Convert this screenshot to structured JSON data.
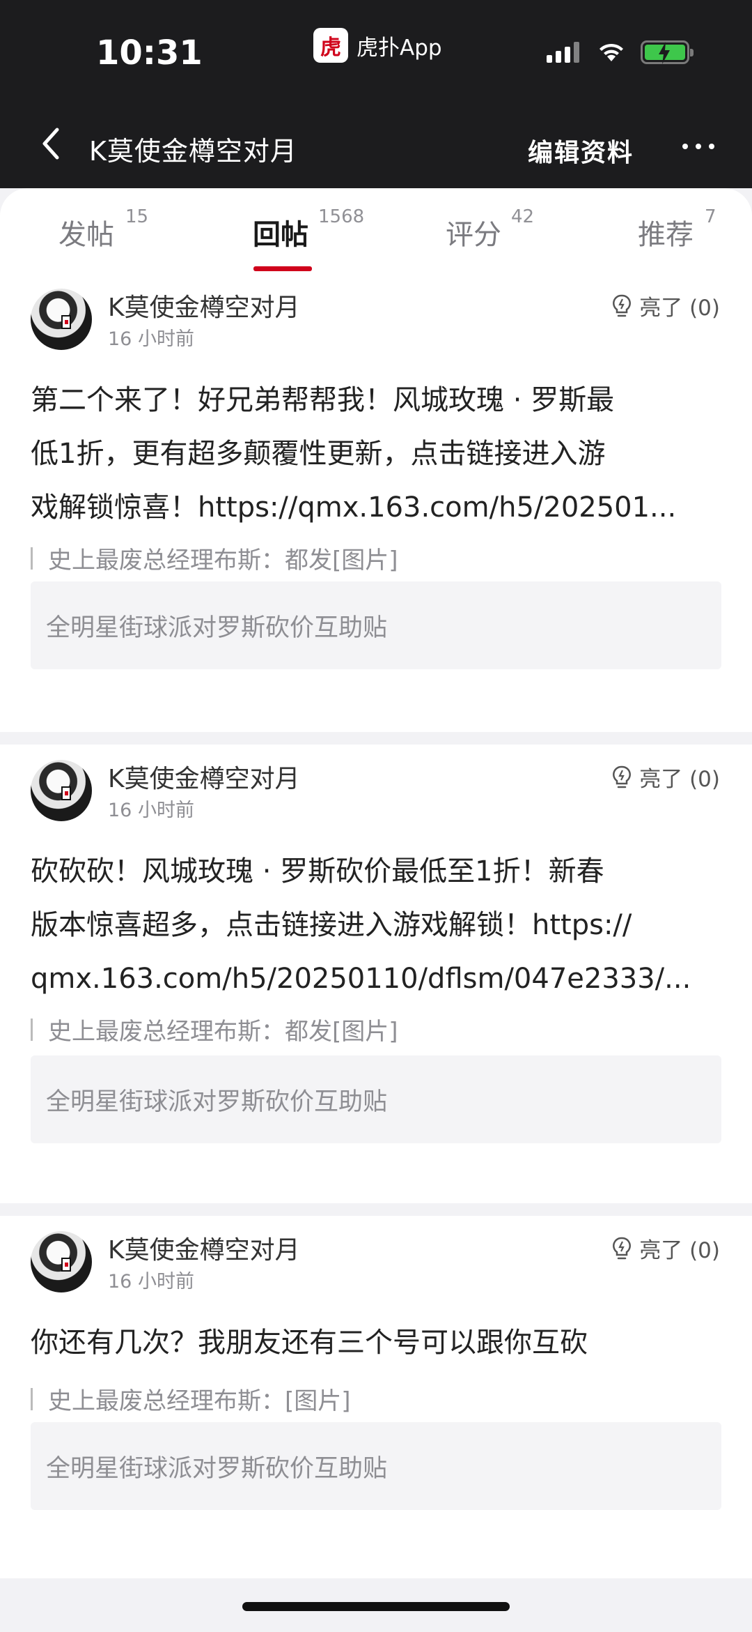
{
  "status_bar": {
    "time": "10:31",
    "app_logo_text": "虎",
    "app_name": "虎扑App",
    "battery_color": "#3ec74b"
  },
  "nav": {
    "title": "K莫使金樽空对月",
    "edit_label": "编辑资料",
    "back_icon": "chevron-left-icon",
    "more_icon": "more-dots-icon"
  },
  "tabs": [
    {
      "label": "发帖",
      "count": "15"
    },
    {
      "label": "回帖",
      "count": "1568",
      "active": true
    },
    {
      "label": "评分",
      "count": "42"
    },
    {
      "label": "推荐",
      "count": "7"
    }
  ],
  "accent_color": "#d0021b",
  "posts": [
    {
      "username": "K莫使金樽空对月",
      "time": "16 小时前",
      "light": "亮了 (0)",
      "lines": [
        "第二个来了！好兄弟帮帮我！风城玫瑰 · 罗斯最",
        "低1折，更有超多颠覆性更新，点击链接进入游",
        "戏解锁惊喜！https://qmx.163.com/h5/202501..."
      ],
      "quote": "史上最废总经理布斯：都发[图片]",
      "topic": "全明星街球派对罗斯砍价互助贴"
    },
    {
      "username": "K莫使金樽空对月",
      "time": "16 小时前",
      "light": "亮了 (0)",
      "lines": [
        "砍砍砍！风城玫瑰 · 罗斯砍价最低至1折！新春",
        "版本惊喜超多，点击链接进入游戏解锁！https://",
        "qmx.163.com/h5/20250110/dflsm/047e2333/..."
      ],
      "quote": "史上最废总经理布斯：都发[图片]",
      "topic": "全明星街球派对罗斯砍价互助贴"
    },
    {
      "username": "K莫使金樽空对月",
      "time": "16 小时前",
      "light": "亮了 (0)",
      "lines": [
        "你还有几次？我朋友还有三个号可以跟你互砍"
      ],
      "quote": "史上最废总经理布斯：[图片]",
      "topic": "全明星街球派对罗斯砍价互助贴"
    }
  ]
}
